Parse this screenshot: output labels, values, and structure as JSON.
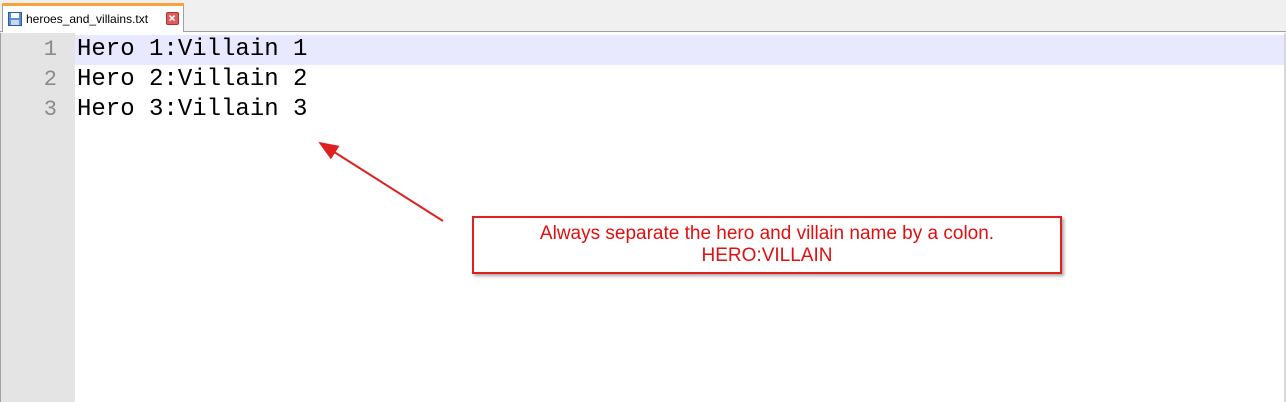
{
  "tab": {
    "filename": "heroes_and_villains.txt",
    "accent_color": "#f9a23a"
  },
  "editor": {
    "line_numbers": [
      "1",
      "2",
      "3"
    ],
    "lines": [
      "Hero 1:Villain 1",
      "Hero 2:Villain 2",
      "Hero 3:Villain 3"
    ],
    "current_line_color": "#e8e8ff"
  },
  "annotation": {
    "line1": "Always separate the hero and villain name by a colon.",
    "line2": "HERO:VILLAIN",
    "color": "#e01010"
  }
}
